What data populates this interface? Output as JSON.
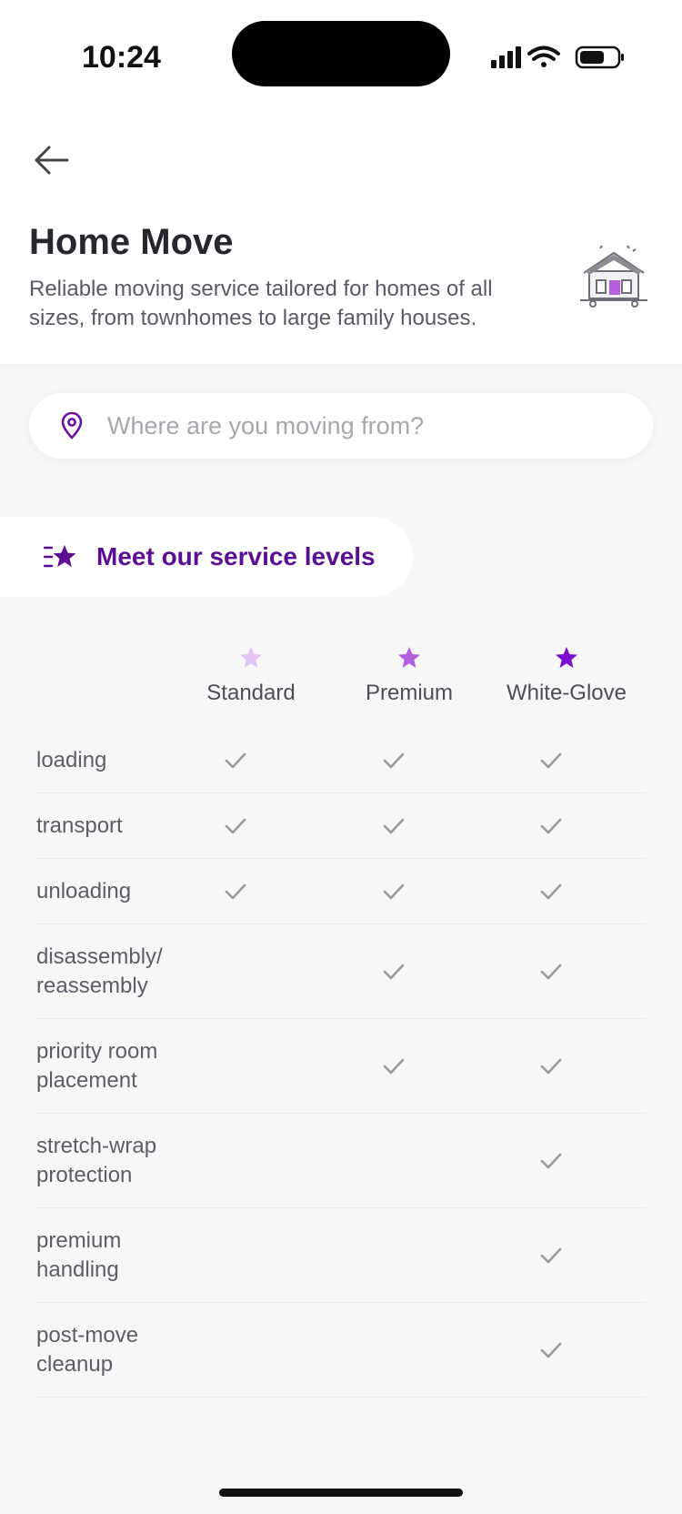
{
  "status_bar": {
    "time": "10:24"
  },
  "header": {
    "title": "Home Move",
    "subtitle": "Reliable moving service tailored for homes of all sizes, from townhomes to large family houses."
  },
  "search": {
    "placeholder": "Where are you moving from?",
    "value": ""
  },
  "service_levels": {
    "label": "Meet our service levels"
  },
  "tiers": [
    {
      "name": "Standard",
      "color": "#e2c4f5"
    },
    {
      "name": "Premium",
      "color": "#b45fe0"
    },
    {
      "name": "White-Glove",
      "color": "#7a0fd0"
    }
  ],
  "features": [
    {
      "name": "loading",
      "included": [
        true,
        true,
        true
      ]
    },
    {
      "name": "transport",
      "included": [
        true,
        true,
        true
      ]
    },
    {
      "name": "unloading",
      "included": [
        true,
        true,
        true
      ]
    },
    {
      "name": "disassembly/ reassembly",
      "included": [
        false,
        true,
        true
      ]
    },
    {
      "name": "priority room placement",
      "included": [
        false,
        true,
        true
      ]
    },
    {
      "name": "stretch-wrap protection",
      "included": [
        false,
        false,
        true
      ]
    },
    {
      "name": "premium handling",
      "included": [
        false,
        false,
        true
      ]
    },
    {
      "name": "post-move cleanup",
      "included": [
        false,
        false,
        true
      ]
    }
  ],
  "colors": {
    "accent": "#5b0e92",
    "check": "#9a9aa2"
  }
}
